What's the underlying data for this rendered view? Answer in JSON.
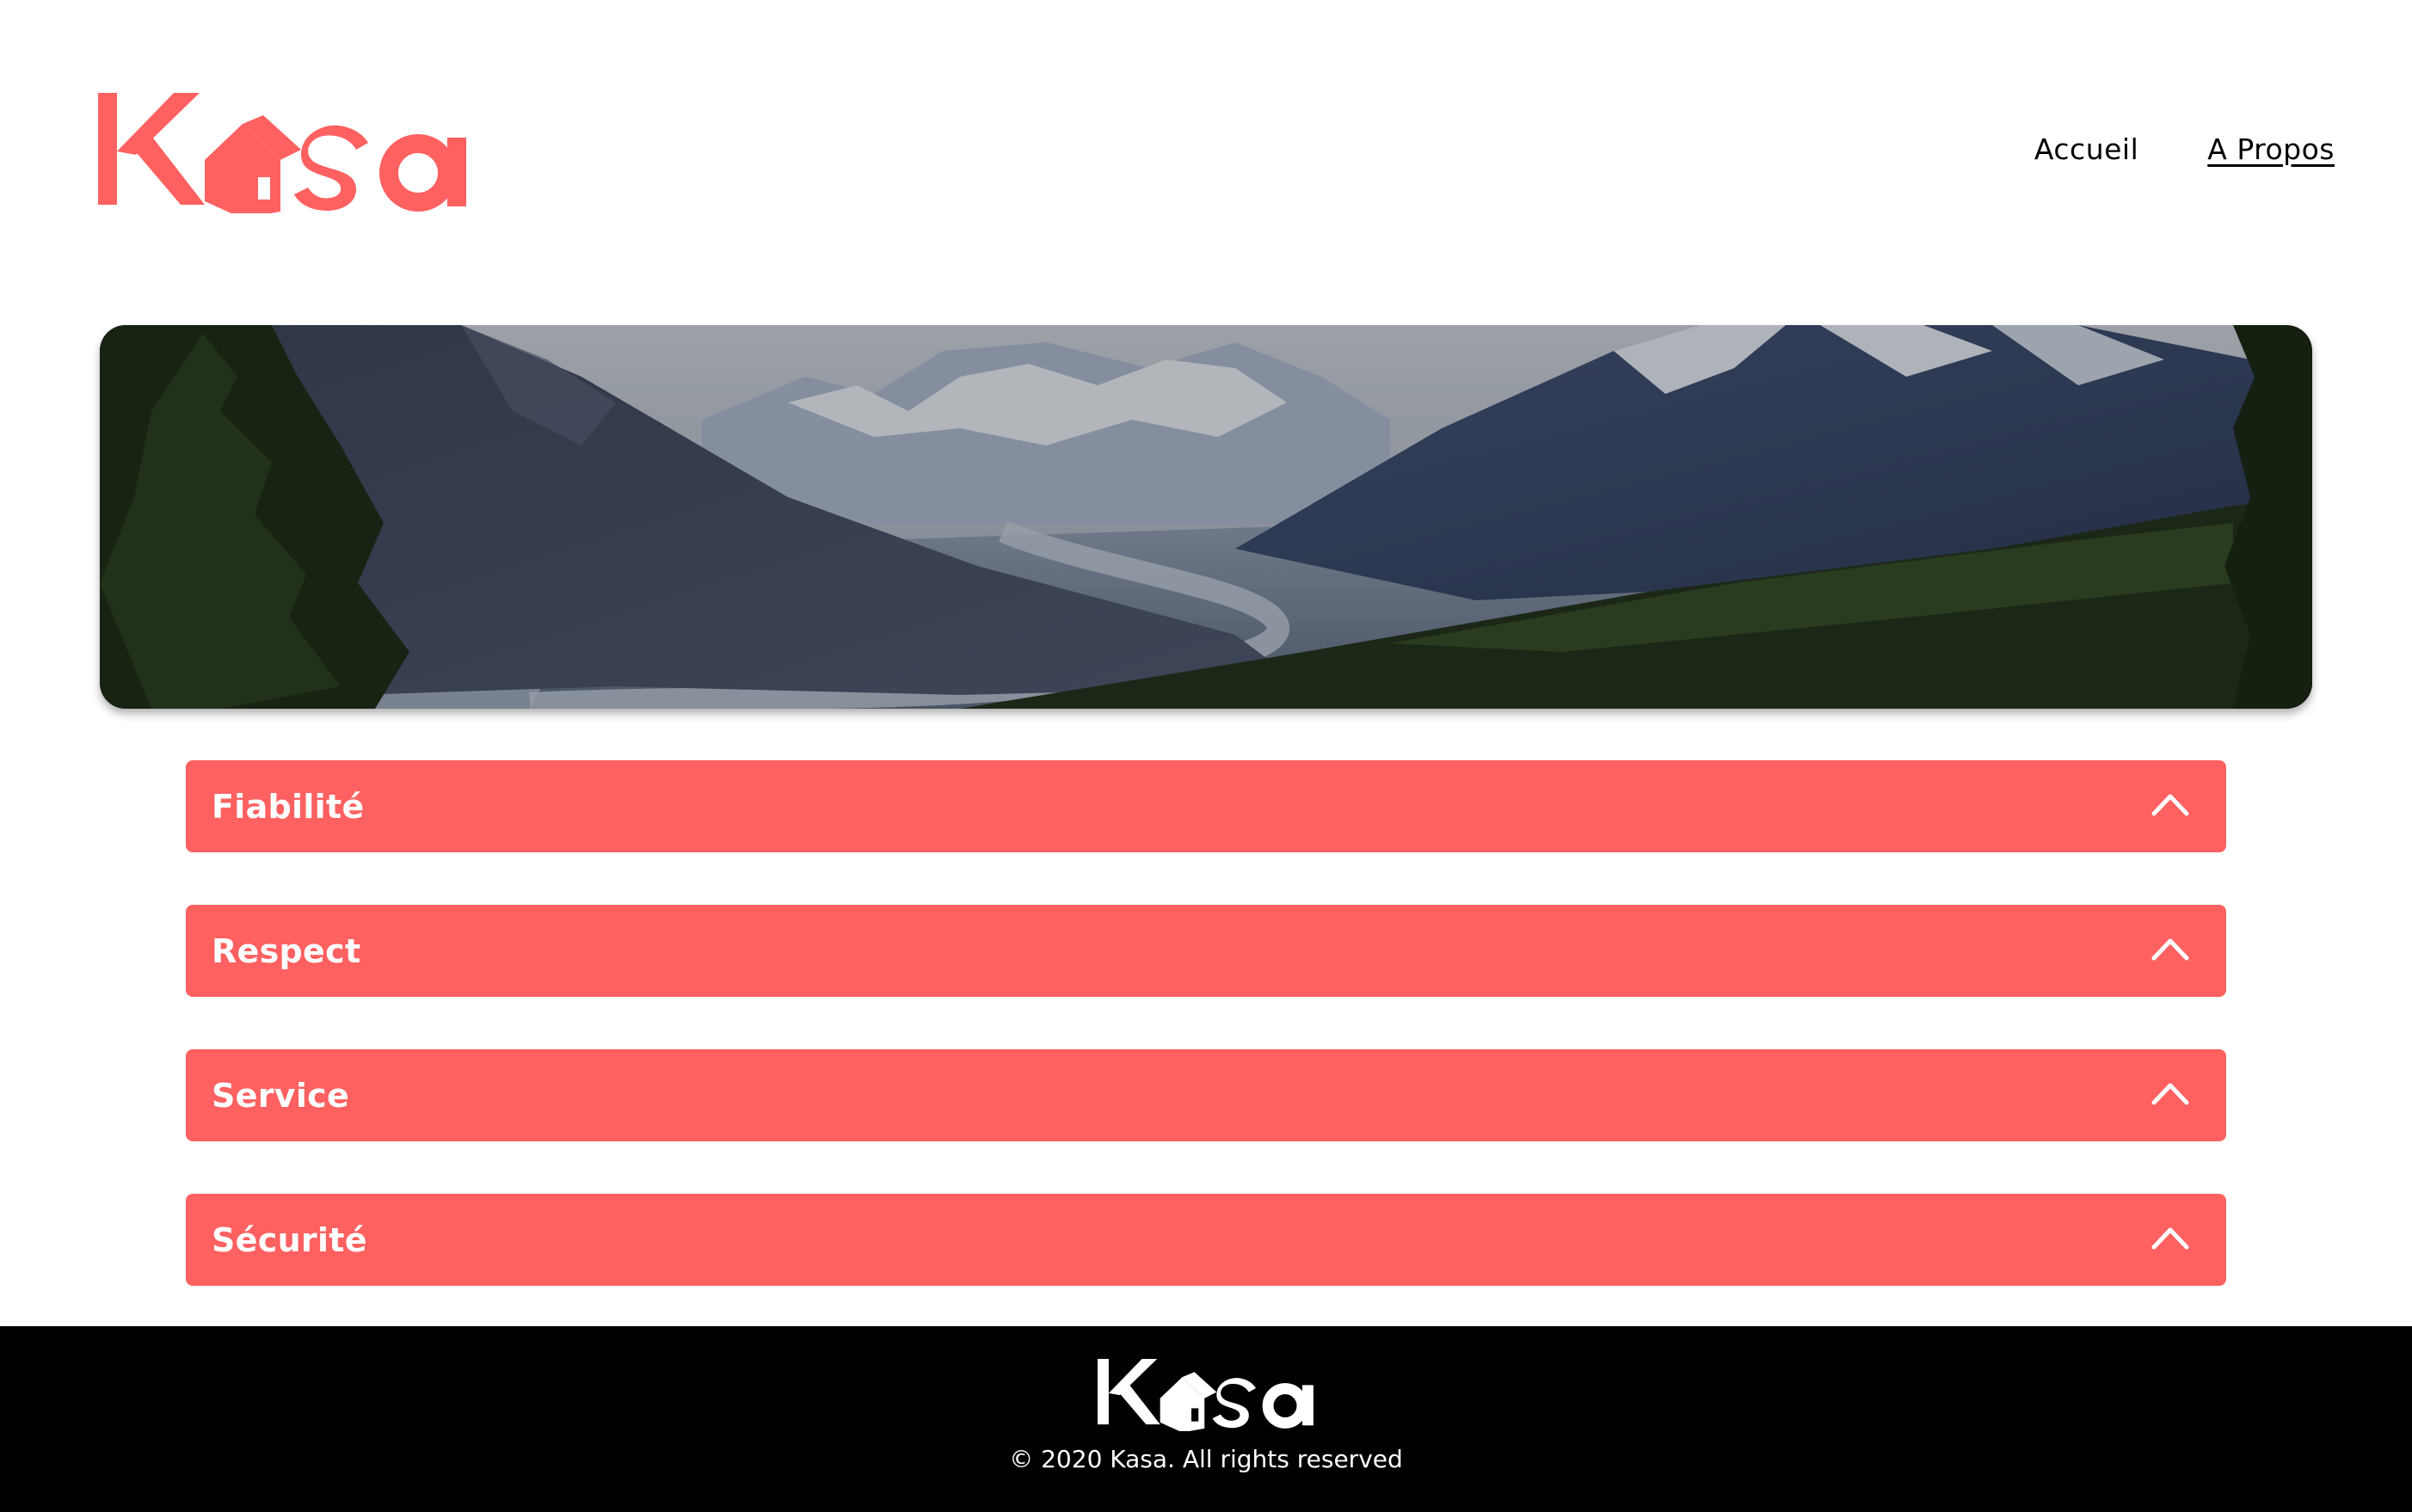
{
  "brand": {
    "name": "Kasa",
    "accent_color": "#ff6060",
    "logo_icon": "house-icon"
  },
  "nav": {
    "items": [
      {
        "label": "Accueil",
        "active": false
      },
      {
        "label": "A Propos",
        "active": true
      }
    ]
  },
  "banner": {
    "image": "mountain-valley-landscape"
  },
  "accordion": {
    "items": [
      {
        "title": "Fiabilité",
        "icon": "chevron-up-icon"
      },
      {
        "title": "Respect",
        "icon": "chevron-up-icon"
      },
      {
        "title": "Service",
        "icon": "chevron-up-icon"
      },
      {
        "title": "Sécurité",
        "icon": "chevron-up-icon"
      }
    ]
  },
  "footer": {
    "copyright": "© 2020 Kasa. All rights reserved",
    "background": "#000000"
  }
}
